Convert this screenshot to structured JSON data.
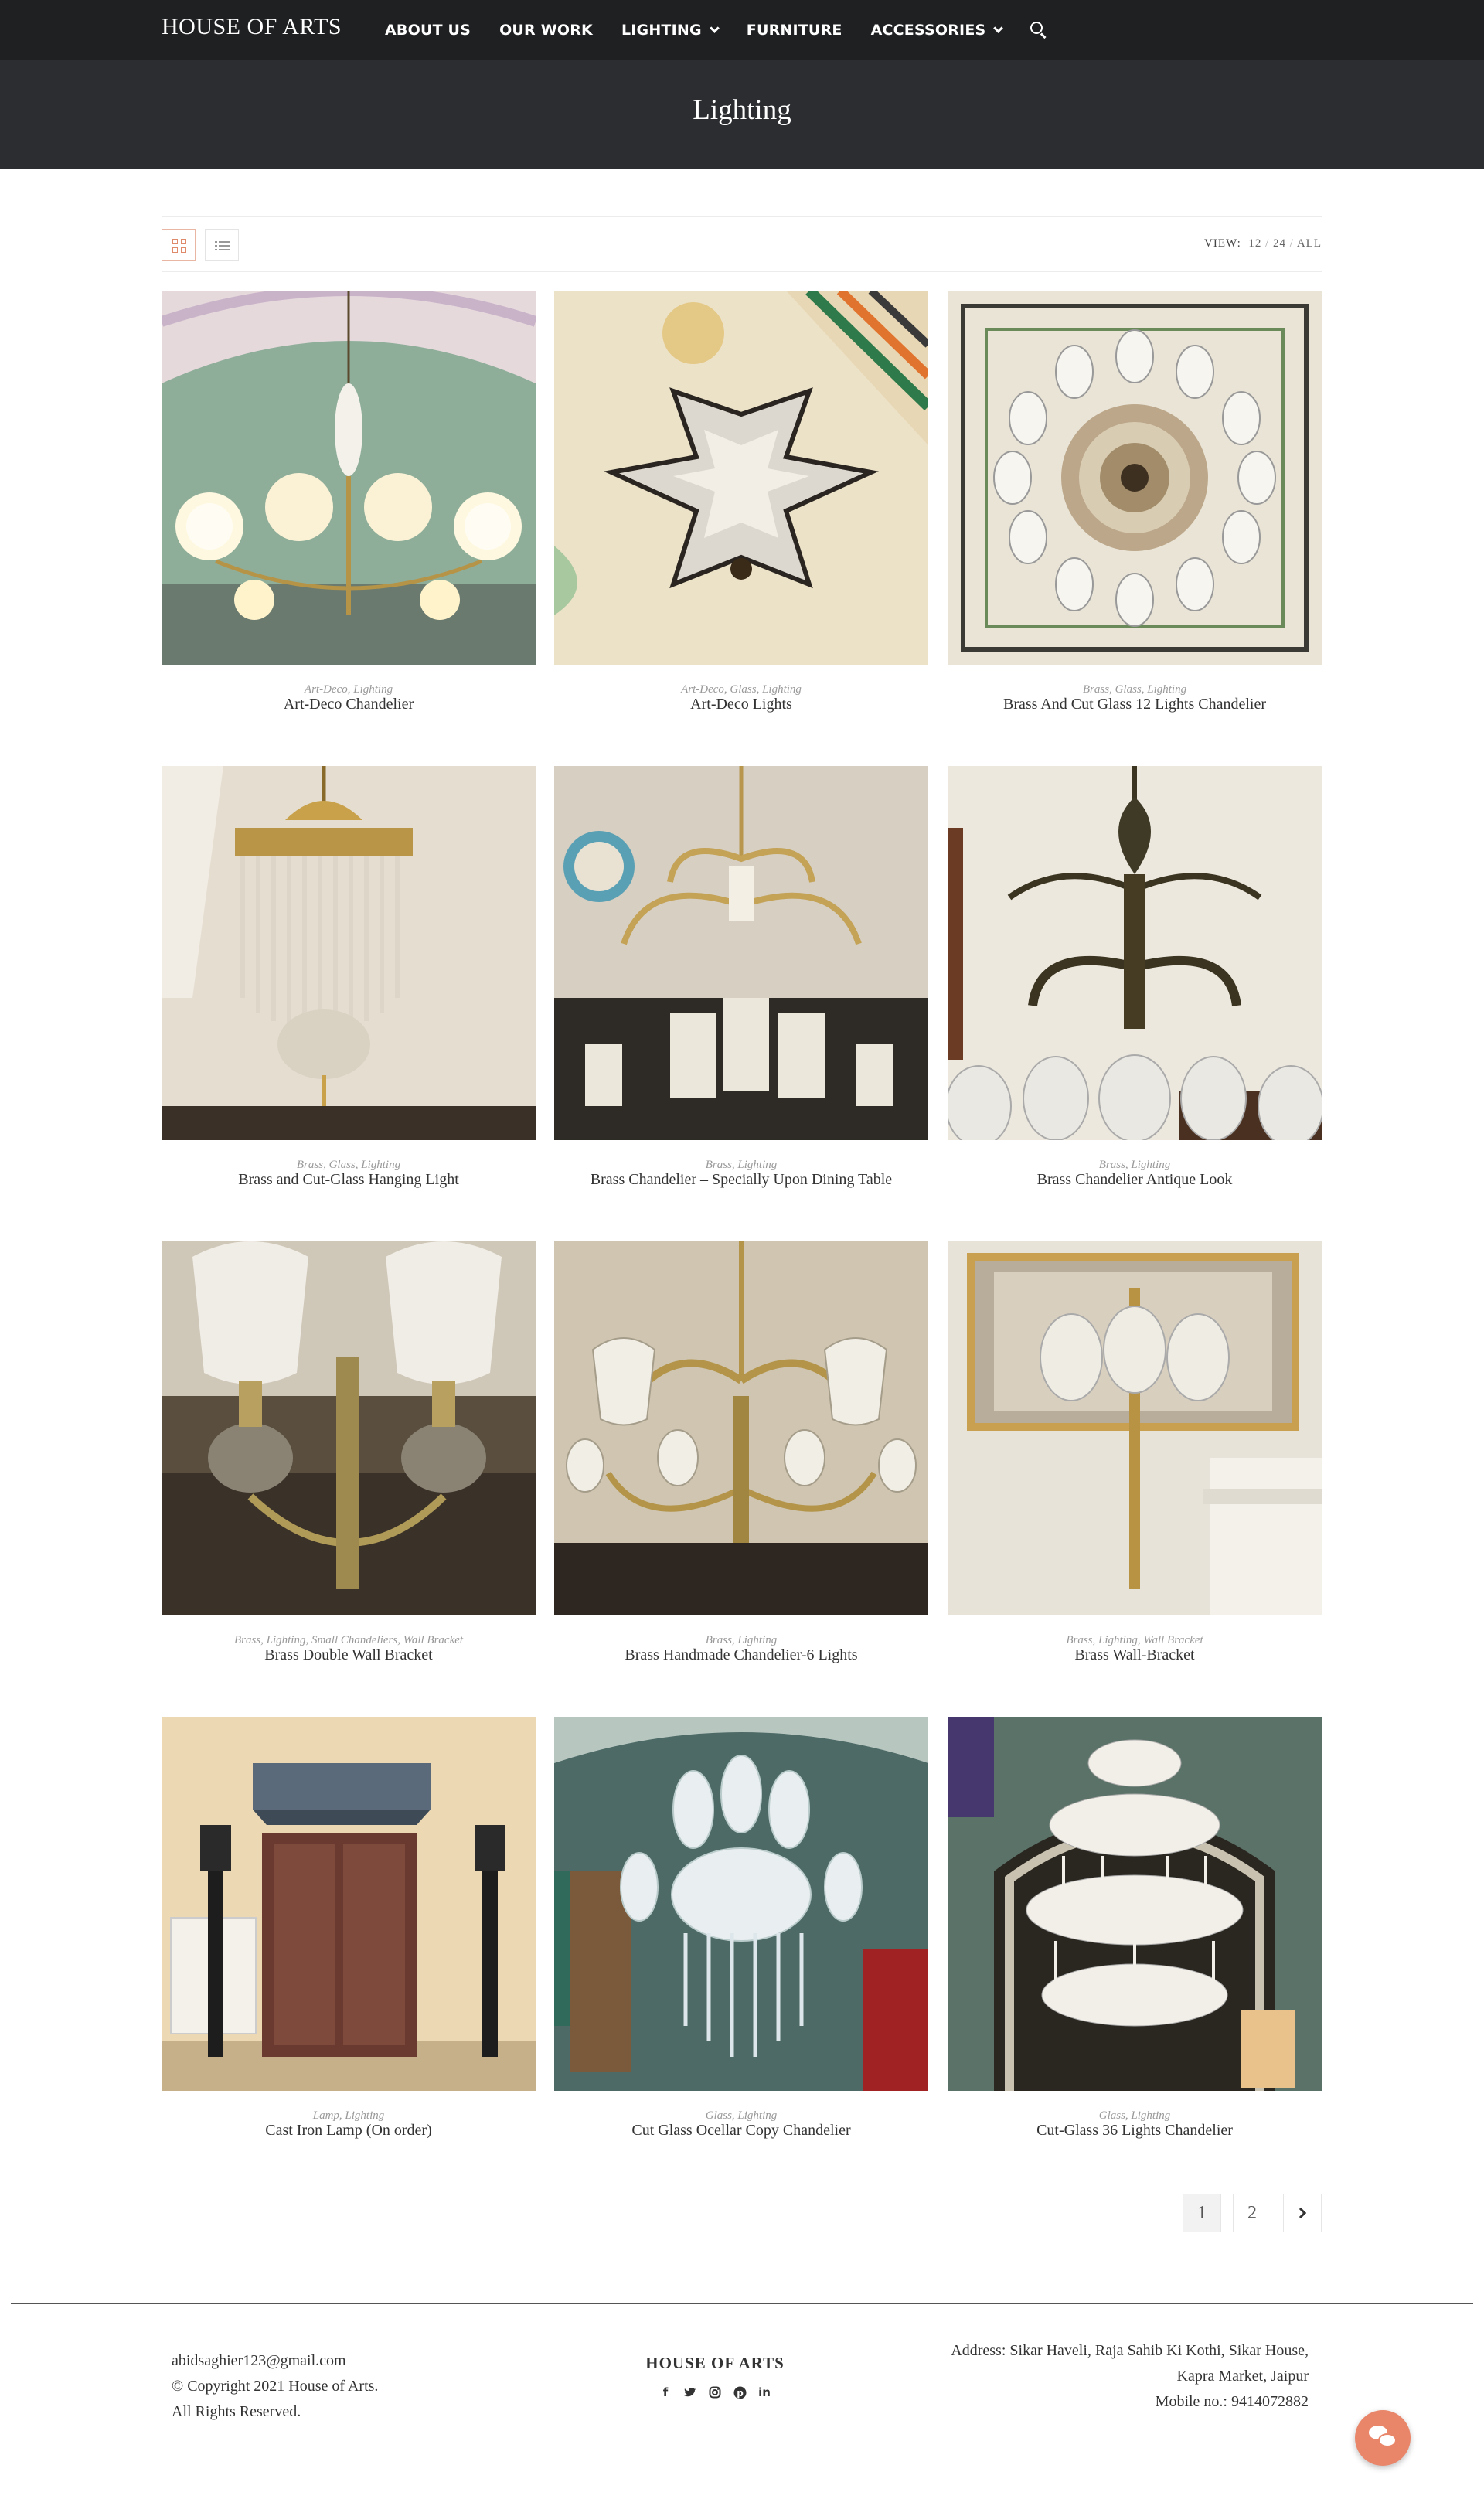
{
  "nav": {
    "logo": "HOUSE OF ARTS",
    "items": [
      {
        "label": "ABOUT US",
        "dropdown": false
      },
      {
        "label": "OUR WORK",
        "dropdown": false
      },
      {
        "label": "LIGHTING",
        "dropdown": true
      },
      {
        "label": "FURNITURE",
        "dropdown": false
      },
      {
        "label": "ACCESSORIES",
        "dropdown": true
      }
    ],
    "search_icon": "search-icon"
  },
  "page_header": {
    "title": "Lighting"
  },
  "toolbar": {
    "view_label": "VIEW:",
    "view_options": [
      "12",
      "24",
      "ALL"
    ],
    "view_selected": "12",
    "layout_selected": "grid"
  },
  "products": [
    {
      "categories": "Art-Deco, Lighting",
      "name": "Art-Deco Chandelier"
    },
    {
      "categories": "Art-Deco, Glass, Lighting",
      "name": "Art-Deco Lights"
    },
    {
      "categories": "Brass, Glass, Lighting",
      "name": "Brass And Cut Glass 12 Lights Chandelier"
    },
    {
      "categories": "Brass, Glass, Lighting",
      "name": "Brass and Cut-Glass Hanging Light"
    },
    {
      "categories": "Brass, Lighting",
      "name": "Brass Chandelier – Specially Upon Dining Table"
    },
    {
      "categories": "Brass, Lighting",
      "name": "Brass Chandelier Antique Look"
    },
    {
      "categories": "Brass, Lighting, Small Chandeliers, Wall Bracket",
      "name": "Brass Double Wall Bracket"
    },
    {
      "categories": "Brass, Lighting",
      "name": "Brass Handmade Chandelier-6 Lights"
    },
    {
      "categories": "Brass, Lighting, Wall Bracket",
      "name": "Brass Wall-Bracket"
    },
    {
      "categories": "Lamp, Lighting",
      "name": "Cast Iron Lamp (On order)"
    },
    {
      "categories": "Glass, Lighting",
      "name": "Cut Glass Ocellar Copy Chandelier"
    },
    {
      "categories": "Glass, Lighting",
      "name": "Cut-Glass 36 Lights Chandelier"
    }
  ],
  "pagination": {
    "pages": [
      "1",
      "2"
    ],
    "current": "1"
  },
  "footer": {
    "email": "abidsaghier123@gmail.com",
    "copyright": "© Copyright 2021 House of Arts.",
    "rights": "All Rights Reserved.",
    "brand": "HOUSE OF ARTS",
    "social_icons": [
      "facebook-icon",
      "twitter-icon",
      "instagram-icon",
      "pinterest-icon",
      "linkedin-icon"
    ],
    "address_line1": "Address: Sikar Haveli, Raja Sahib Ki Kothi, Sikar House,",
    "address_line2": "Kapra Market, Jaipur",
    "mobile": "Mobile no.: 9414072882"
  },
  "colors": {
    "nav_bg": "#1f2022",
    "header_bg": "#2c2d30",
    "accent": "#e9866a"
  }
}
